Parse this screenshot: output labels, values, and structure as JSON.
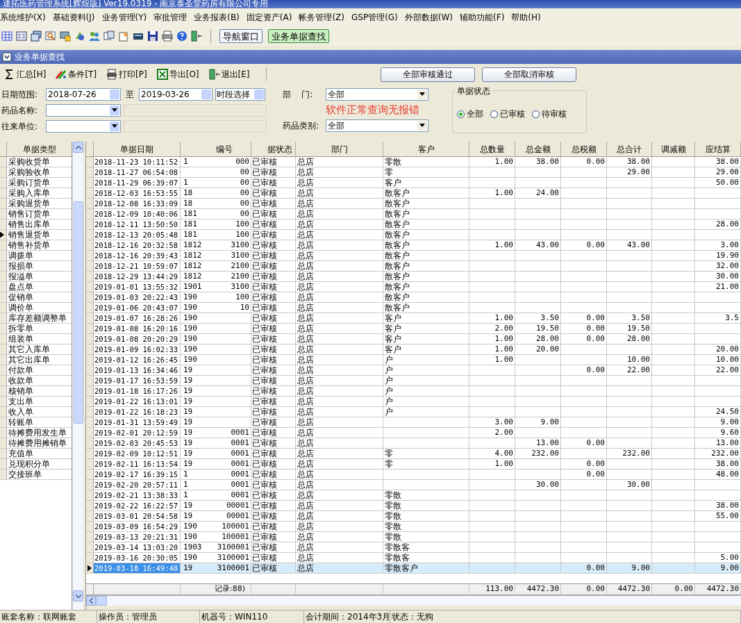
{
  "window": {
    "title": "速拓医药管理系统[辉煌版] Ver19.0319  -  南京泰圣堂药房有限公司专用"
  },
  "menu": [
    "系统维护(X)",
    "基础资料(J)",
    "业务管理(Y)",
    "审批管理",
    "业务报表(B)",
    "固定资产(A)",
    "帐务管理(Z)",
    "GSP管理(G)",
    "外部数据(W)",
    "辅助功能(F)",
    "帮助(H)"
  ],
  "toolbar_buttons": [
    {
      "label": "导航窗口",
      "selected": false
    },
    {
      "label": "业务单据查找",
      "selected": true
    }
  ],
  "subwindow": {
    "title": "业务单据查找"
  },
  "actions": [
    {
      "kind": "sum",
      "label": "汇总[H]"
    },
    {
      "kind": "filter",
      "label": "条件[T]"
    },
    {
      "kind": "print",
      "label": "打印[P]"
    },
    {
      "kind": "export",
      "label": "导出[O]"
    },
    {
      "kind": "exit",
      "label": "退出[E]"
    }
  ],
  "audit_buttons": [
    "全部审核通过",
    "全部取消审核"
  ],
  "filters": {
    "date_label": "日期范围:",
    "date_from": "2018-07-26",
    "to_label": "至",
    "date_to": "2019-03-26",
    "period": "时段选择",
    "dept_label": "部    门:",
    "dept": "全部",
    "drug_label": "药品名称:",
    "partner_label": "往来单位:",
    "note": "软件正常查询无报错",
    "category_label": "药品类别:",
    "category": "全部"
  },
  "status_filter": {
    "title": "单据状态",
    "options": [
      {
        "label": "全部",
        "selected": true
      },
      {
        "label": "已审核",
        "selected": false
      },
      {
        "label": "待审核",
        "selected": false
      }
    ]
  },
  "doc_types": {
    "header": "单据类型",
    "items": [
      {
        "label": "采购收货单",
        "selected": false
      },
      {
        "label": "采购验收单",
        "selected": false
      },
      {
        "label": "采购订货单",
        "selected": false
      },
      {
        "label": "采购入库单",
        "selected": false
      },
      {
        "label": "采购退货单",
        "selected": false
      },
      {
        "label": "销售订货单",
        "selected": false
      },
      {
        "label": "销售出库单",
        "selected": false
      },
      {
        "label": "销售退货单",
        "selected": true
      },
      {
        "label": "销售补货单",
        "selected": false
      },
      {
        "label": "调拨单",
        "selected": false
      },
      {
        "label": "报损单",
        "selected": false
      },
      {
        "label": "报溢单",
        "selected": false
      },
      {
        "label": "盘点单",
        "selected": false
      },
      {
        "label": "促销单",
        "selected": false
      },
      {
        "label": "调价单",
        "selected": false
      },
      {
        "label": "库存差额调整单",
        "selected": false
      },
      {
        "label": "拆零单",
        "selected": false
      },
      {
        "label": "组装单",
        "selected": false
      },
      {
        "label": "其它入库单",
        "selected": false
      },
      {
        "label": "其它出库单",
        "selected": false
      },
      {
        "label": "付款单",
        "selected": false
      },
      {
        "label": "收款单",
        "selected": false
      },
      {
        "label": "核销单",
        "selected": false
      },
      {
        "label": "支出单",
        "selected": false
      },
      {
        "label": "收入单",
        "selected": false
      },
      {
        "label": "转账单",
        "selected": false
      },
      {
        "label": "待摊费用发生单",
        "selected": false
      },
      {
        "label": "待摊费用摊销单",
        "selected": false
      },
      {
        "label": "充值单",
        "selected": false
      },
      {
        "label": "兑现积分单",
        "selected": false
      },
      {
        "label": "交接班单",
        "selected": false
      }
    ]
  },
  "table": {
    "columns": [
      "单据日期",
      "编号",
      "据状态",
      "部门",
      "客户",
      "总数量",
      "总金额",
      "总税额",
      "总合计",
      "调减额",
      "应结算"
    ],
    "rows": [
      {
        "selected": false,
        "date": "2018-11-23 10:11:52",
        "no_start": "1",
        "no_end": "000",
        "status": "已审核",
        "dept": "总店",
        "customer": "零散",
        "qty": "1.00",
        "amount": "38.00",
        "tax": "0.00",
        "total": "38.00",
        "settle": "38.00"
      },
      {
        "selected": false,
        "date": "2018-11-27 06:54:08",
        "no_end": "00",
        "status": "已审核",
        "dept": "总店",
        "customer": "零",
        "total": "29.00",
        "settle": "29.00"
      },
      {
        "selected": false,
        "date": "2018-11-29 06:39:07",
        "no_start": "1",
        "no_end": "00",
        "status": "已审核",
        "dept": "总店",
        "customer": "客户",
        "settle": "50.00"
      },
      {
        "selected": false,
        "date": "2018-12-03 16:53:55",
        "no_start": "18",
        "no_end": "00",
        "status": "已审核",
        "dept": "总店",
        "customer": "散客户",
        "qty": "1.00",
        "amount": "24.00"
      },
      {
        "selected": false,
        "date": "2018-12-08 16:33:09",
        "no_start": "18",
        "no_end": "00",
        "status": "已审核",
        "dept": "总店",
        "customer": "散客户"
      },
      {
        "selected": false,
        "date": "2018-12-09 10:40:06",
        "no_start": "181",
        "no_end": "00",
        "status": "已审核",
        "dept": "总店",
        "customer": "散客户"
      },
      {
        "selected": false,
        "date": "2018-12-11 13:50:50",
        "no_start": "181",
        "no_end": "100",
        "status": "已审核",
        "dept": "总店",
        "customer": "散客户",
        "settle": "28.00"
      },
      {
        "selected": false,
        "date": "2018-12-13 20:05:48",
        "no_start": "181",
        "no_end": "100",
        "status": "已审核",
        "dept": "总店",
        "customer": "散客户"
      },
      {
        "selected": false,
        "date": "2018-12-16 20:32:58",
        "no_start": "1812",
        "no_end": "3100",
        "status": "已审核",
        "dept": "总店",
        "customer": "散客户",
        "qty": "1.00",
        "amount": "43.00",
        "tax": "0.00",
        "total": "43.00",
        "settle": "3.00"
      },
      {
        "selected": false,
        "date": "2018-12-16 20:39:43",
        "no_start": "1812",
        "no_end": "3100",
        "status": "已审核",
        "dept": "总店",
        "customer": "散客户",
        "settle": "19.90"
      },
      {
        "selected": false,
        "date": "2018-12-21 10:59:07",
        "no_start": "1812",
        "no_end": "2100",
        "status": "已审核",
        "dept": "总店",
        "customer": "散客户",
        "settle": "32.00"
      },
      {
        "selected": false,
        "date": "2018-12-29 13:44:29",
        "no_start": "1812",
        "no_end": "2100",
        "status": "已审核",
        "dept": "总店",
        "customer": "散客户",
        "settle": "30.00"
      },
      {
        "selected": false,
        "date": "2019-01-01 13:55:32",
        "no_start": "1901",
        "no_end": "3100",
        "status": "已审核",
        "dept": "总店",
        "customer": "散客户",
        "settle": "21.00"
      },
      {
        "selected": false,
        "date": "2019-01-03 20:22:43",
        "no_start": "190",
        "no_end": "100",
        "status": "已审核",
        "dept": "总店",
        "customer": "散客户"
      },
      {
        "selected": false,
        "date": "2019-01-06 20:43:07",
        "no_start": "190",
        "no_end": "10",
        "status": "已审核",
        "dept": "总店",
        "customer": "散客户"
      },
      {
        "selected": false,
        "date": "2019-01-07 16:28:26",
        "no_start": "190",
        "status": "已审核",
        "dept": "总店",
        "customer": "客户",
        "qty": "1.00",
        "amount": "3.50",
        "tax": "0.00",
        "total": "3.50",
        "settle": "3.5"
      },
      {
        "selected": false,
        "date": "2019-01-08 16:20:16",
        "no_start": "190",
        "status": "已审核",
        "dept": "总店",
        "customer": "客户",
        "qty": "2.00",
        "amount": "19.50",
        "tax": "0.00",
        "total": "19.50"
      },
      {
        "selected": false,
        "date": "2019-01-08 20:20:29",
        "no_start": "190",
        "status": "已审核",
        "dept": "总店",
        "customer": "客户",
        "qty": "1.00",
        "amount": "28.00",
        "tax": "0.00",
        "total": "28.00"
      },
      {
        "selected": false,
        "date": "2019-01-09 16:02:33",
        "no_start": "190",
        "status": "已审核",
        "dept": "总店",
        "customer": "客户",
        "qty": "1.00",
        "amount": "20.00",
        "settle": "20.00"
      },
      {
        "selected": false,
        "date": "2019-01-12 16:26:45",
        "no_start": "190",
        "status": "已审核",
        "dept": "总店",
        "customer": "户",
        "qty": "1.00",
        "total": "10.00",
        "settle": "10.00"
      },
      {
        "selected": false,
        "date": "2019-01-13 16:34:46",
        "no_start": "19",
        "status": "已审核",
        "dept": "总店",
        "customer": "户",
        "tax": "0.00",
        "total": "22.00",
        "settle": "22.00"
      },
      {
        "selected": false,
        "date": "2019-01-17 16:53:59",
        "no_start": "19",
        "status": "已审核",
        "dept": "总店",
        "customer": "户"
      },
      {
        "selected": false,
        "date": "2019-01-18 16:17:26",
        "no_start": "19",
        "status": "已审核",
        "dept": "总店",
        "customer": "户"
      },
      {
        "selected": false,
        "date": "2019-01-22 16:13:01",
        "no_start": "19",
        "status": "已审核",
        "dept": "总店",
        "customer": "户"
      },
      {
        "selected": false,
        "date": "2019-01-22 16:18:23",
        "no_start": "19",
        "status": "已审核",
        "dept": "总店",
        "customer": "户",
        "settle": "24.50"
      },
      {
        "selected": false,
        "date": "2019-01-31 13:59:49",
        "no_start": "19",
        "status": "已审核",
        "dept": "总店",
        "qty": "3.00",
        "amount": "9.00",
        "settle": "9.00"
      },
      {
        "selected": false,
        "date": "2019-02-01 20:12:59",
        "no_start": "19",
        "no_end": "0001",
        "status": "已审核",
        "dept": "总店",
        "qty": "2.00",
        "settle": "9.60"
      },
      {
        "selected": false,
        "date": "2019-02-03 20:45:53",
        "no_start": "19",
        "no_end": "0001",
        "status": "已审核",
        "dept": "总店",
        "amount": "13.00",
        "tax": "0.00",
        "settle": "13.00"
      },
      {
        "selected": false,
        "date": "2019-02-09 10:12:51",
        "no_start": "19",
        "no_end": "0001",
        "status": "已审核",
        "dept": "总店",
        "customer": "零",
        "qty": "4.00",
        "amount": "232.00",
        "total": "232.00",
        "settle": "232.00"
      },
      {
        "selected": false,
        "date": "2019-02-11 16:13:54",
        "no_start": "19",
        "no_end": "0001",
        "status": "已审核",
        "dept": "总店",
        "customer": "零",
        "qty": "1.00",
        "tax": "0.00",
        "settle": "38.00"
      },
      {
        "selected": false,
        "date": "2019-02-17 16:39:15",
        "no_start": "1",
        "no_end": "0001",
        "status": "已审核",
        "dept": "总店",
        "tax": "0.00",
        "settle": "48.00"
      },
      {
        "selected": false,
        "date": "2019-02-20 20:57:11",
        "no_start": "1",
        "no_end": "0001",
        "status": "已审核",
        "dept": "总店",
        "amount": "30.00",
        "total": "30.00"
      },
      {
        "selected": false,
        "date": "2019-02-21 13:38:33",
        "no_start": "1",
        "no_end": "0001",
        "status": "已审核",
        "dept": "总店",
        "customer": "零散"
      },
      {
        "selected": false,
        "date": "2019-02-22 16:22:57",
        "no_start": "19",
        "no_end": "00001",
        "status": "已审核",
        "dept": "总店",
        "customer": "零散",
        "settle": "38.00"
      },
      {
        "selected": false,
        "date": "2019-03-01 20:54:58",
        "no_start": "19",
        "no_end": "00001",
        "status": "已审核",
        "dept": "总店",
        "customer": "零散",
        "settle": "55.00"
      },
      {
        "selected": false,
        "date": "2019-03-09 16:54:29",
        "no_start": "190",
        "no_end": "100001",
        "status": "已审核",
        "dept": "总店",
        "customer": "零散"
      },
      {
        "selected": false,
        "date": "2019-03-13 20:21:31",
        "no_start": "190",
        "no_end": "100001",
        "status": "已审核",
        "dept": "总店",
        "customer": "零散"
      },
      {
        "selected": false,
        "date": "2019-03-14 13:03:20",
        "no_start": "1903",
        "no_end": "3100001",
        "status": "已审核",
        "dept": "总店",
        "customer": "零散客"
      },
      {
        "selected": false,
        "date": "2019-03-16 20:30:05",
        "no_start": "190",
        "no_end": "3100001",
        "status": "已审核",
        "dept": "总店",
        "customer": "零散客",
        "settle": "5.00"
      },
      {
        "selected": true,
        "date": "2019-03-18 16:49:48",
        "no_start": "19",
        "no_end": "3100001",
        "status": "已审核",
        "dept": "总店",
        "customer": "零散客户",
        "tax": "0.00",
        "total": "9.00",
        "settle": "9.00"
      }
    ],
    "footer": {
      "count": "记录:88)",
      "qty": "113.00",
      "amount": "4472.30",
      "tax": "0.00",
      "total": "4472.30",
      "adj": "0.00",
      "settle": "4472.30"
    }
  },
  "status_bar": [
    "账套名称：联网账套",
    "操作员：管理员",
    "机器号：WIN110",
    "会计期间：2014年3月",
    "状态：无狗"
  ]
}
